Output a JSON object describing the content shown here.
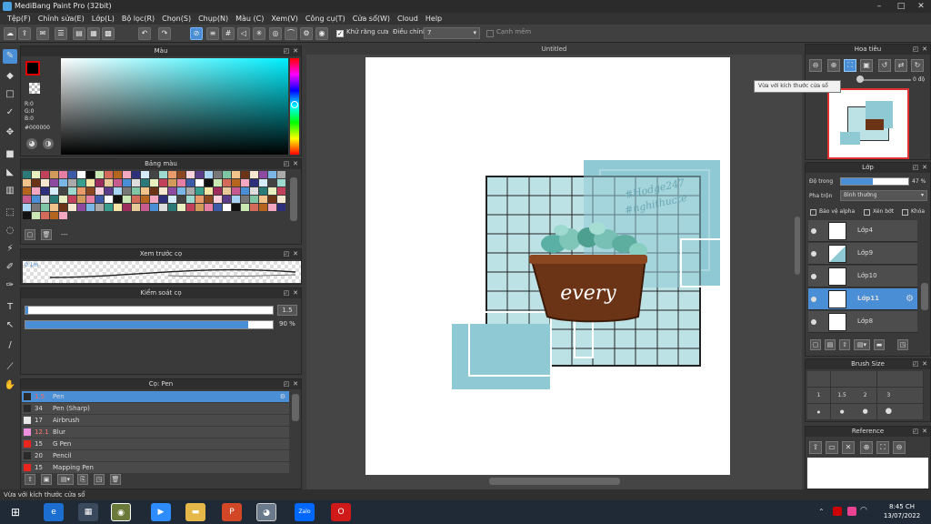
{
  "app": {
    "title": "MediBang Paint Pro (32bit)"
  },
  "menu": [
    "Tệp(F)",
    "Chỉnh sửa(E)",
    "Lớp(L)",
    "Bộ lọc(R)",
    "Chọn(S)",
    "Chụp(N)",
    "Màu (C)",
    "Xem(V)",
    "Công cụ(T)",
    "Cửa sổ(W)",
    "Cloud",
    "Help"
  ],
  "toolbar": {
    "antialias_label": "Khử răng cưa",
    "adjust_label": "Điều chỉnh",
    "adjust_value": "7",
    "edge_label": "Cạnh mềm"
  },
  "color_panel": {
    "title": "Màu",
    "r": "R:0",
    "g": "G:0",
    "b": "B:0",
    "hex": "#000000"
  },
  "palette": {
    "title": "Bảng màu",
    "footer": "---"
  },
  "preview": {
    "title": "Xem trước cọ",
    "value": "0.1m"
  },
  "brush_control": {
    "title": "Kiểm soát cọ",
    "size": "1.5",
    "opacity": "90",
    "opacity_unit": "%"
  },
  "brush_list": {
    "title": "Cọ: Pen",
    "items": [
      {
        "size": "1.5",
        "name": "Pen",
        "color": "#2a2a2a"
      },
      {
        "size": "34",
        "name": "Pen (Sharp)",
        "color": "#2a2a2a"
      },
      {
        "size": "17",
        "name": "Airbrush",
        "color": "#e8e8e8"
      },
      {
        "size": "12.1",
        "name": "Blur",
        "color": "#ef8fe0"
      },
      {
        "size": "15",
        "name": "G Pen",
        "color": "#e8251f"
      },
      {
        "size": "20",
        "name": "Pencil",
        "color": "#2a2a2a"
      },
      {
        "size": "15",
        "name": "Mapping Pen",
        "color": "#e8251f"
      }
    ]
  },
  "document": {
    "tab": "Untitled"
  },
  "navigator": {
    "title": "Hoa tiêu",
    "angle": "0 độ",
    "tooltip": "Vừa với kích thước cửa sổ"
  },
  "layers": {
    "title": "Lớp",
    "opacity_label": "Độ trong",
    "opacity_value": "47 %",
    "blend_label": "Pha trộn",
    "blend_value": "Bình thường",
    "protect_alpha": "Bảo vệ alpha",
    "clipping": "Xén bớt",
    "lock": "Khóa",
    "items": [
      "Lớp4",
      "Lớp9",
      "Lớp10",
      "Lớp11",
      "Lớp8"
    ],
    "selected": "Lớp11"
  },
  "brush_size": {
    "title": "Brush Size",
    "labels": [
      "1",
      "1.5",
      "2",
      "3"
    ]
  },
  "reference": {
    "title": "Reference"
  },
  "status": {
    "text": "Vừa với kích thước cửa sổ"
  },
  "artwork": {
    "pot_text": "every",
    "hashtag_1": "#Hodge247",
    "hashtag_2": "#nghithucte"
  },
  "clock": {
    "time": "8:45 CH",
    "date": "13/07/2022"
  },
  "colors": {
    "accent": "#4a8ed6",
    "teal": "#8fc9d3",
    "grid_bg": "#bde2e6"
  }
}
